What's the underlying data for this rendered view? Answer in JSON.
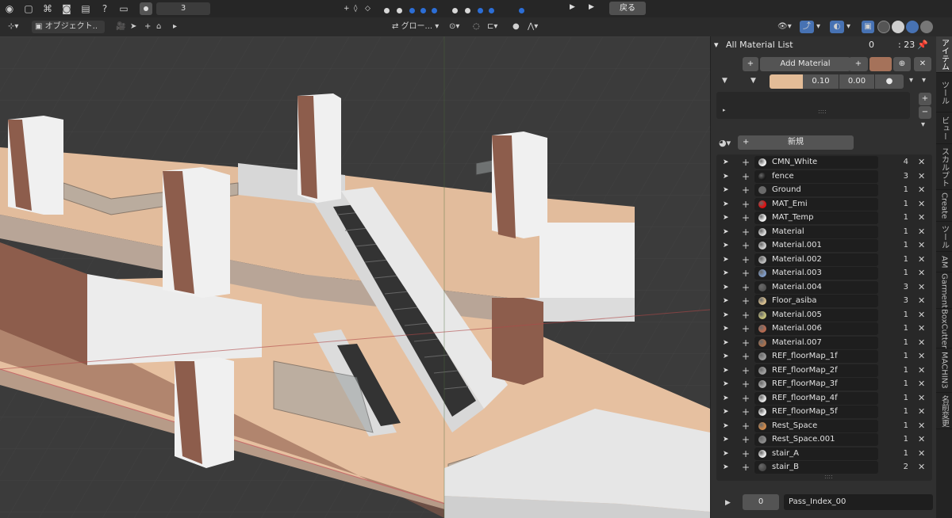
{
  "topbar": {
    "frame_value": "3",
    "back_label": "戻る"
  },
  "header": {
    "mode_label": "オブジェクト..",
    "transform_label": "グロー..."
  },
  "panel": {
    "title": "All Material List",
    "title_value": "0",
    "title_value2": ": 23",
    "add_material_label": "Add Material",
    "swatch_color": "#a5725a",
    "base_color": "#e3bc97",
    "value1": "0.10",
    "value2": "0.00",
    "new_label": "新規",
    "pass_index_value": "0",
    "pass_index_name": "Pass_Index_00"
  },
  "materials": [
    {
      "name": "CMN_White",
      "count": "4",
      "color": "#f2f2f2"
    },
    {
      "name": "fence",
      "count": "3",
      "color": "#1a1a1a"
    },
    {
      "name": "Ground",
      "count": "1",
      "color": "#6a6a6a"
    },
    {
      "name": "MAT_Emi",
      "count": "1",
      "color": "#e01010"
    },
    {
      "name": "MAT_Temp",
      "count": "1",
      "color": "#f5f5f5"
    },
    {
      "name": "Material",
      "count": "1",
      "color": "#dcdcdc"
    },
    {
      "name": "Material.001",
      "count": "1",
      "color": "#cfcfcf"
    },
    {
      "name": "Material.002",
      "count": "1",
      "color": "#bdbdbd"
    },
    {
      "name": "Material.003",
      "count": "1",
      "color": "#7f9cc8"
    },
    {
      "name": "Material.004",
      "count": "3",
      "color": "#555555"
    },
    {
      "name": "Floor_asiba",
      "count": "3",
      "color": "#d8c090"
    },
    {
      "name": "Material.005",
      "count": "1",
      "color": "#c6c27a"
    },
    {
      "name": "Material.006",
      "count": "1",
      "color": "#b86a50"
    },
    {
      "name": "Material.007",
      "count": "1",
      "color": "#a8704e"
    },
    {
      "name": "REF_floorMap_1f",
      "count": "1",
      "color": "#9a9a9a"
    },
    {
      "name": "REF_floorMap_2f",
      "count": "1",
      "color": "#a0a0a0"
    },
    {
      "name": "REF_floorMap_3f",
      "count": "1",
      "color": "#b0b0b0"
    },
    {
      "name": "REF_floorMap_4f",
      "count": "1",
      "color": "#e8e8e8"
    },
    {
      "name": "REF_floorMap_5f",
      "count": "1",
      "color": "#f0f0f0"
    },
    {
      "name": "Rest_Space",
      "count": "1",
      "color": "#d08a4a"
    },
    {
      "name": "Rest_Space.001",
      "count": "1",
      "color": "#8c8c8c"
    },
    {
      "name": "stair_A",
      "count": "1",
      "color": "#ececec"
    },
    {
      "name": "stair_B",
      "count": "2",
      "color": "#4a4a4a"
    }
  ],
  "tabs": [
    {
      "label": "アイテム",
      "active": true
    },
    {
      "label": "ツール",
      "active": false
    },
    {
      "label": "ビュー",
      "active": false
    },
    {
      "label": "スカルプト",
      "active": false
    },
    {
      "label": "Create",
      "active": false
    },
    {
      "label": "ツール",
      "active": false
    },
    {
      "label": "AM",
      "active": false
    },
    {
      "label": "Garment",
      "active": false
    },
    {
      "label": "BoxCutter",
      "active": false
    },
    {
      "label": "MACHIN3",
      "active": false
    },
    {
      "label": "名前変更",
      "active": false
    }
  ]
}
